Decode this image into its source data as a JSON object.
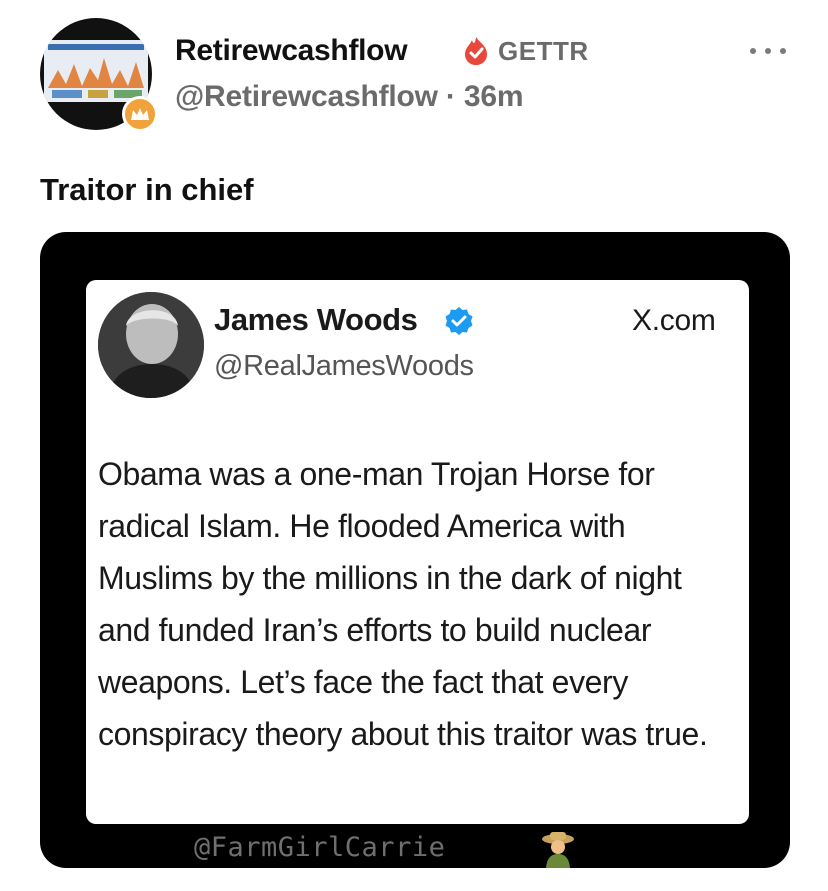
{
  "post": {
    "author_name": "Retirewcashflow",
    "platform": "GETTR",
    "handle_time": "@Retirewcashflow · 36m",
    "text": "Traitor in chief",
    "avatar_icon": "chart-avatar",
    "badge_icon": "crown-badge-icon",
    "verified_icon": "red-verified-flame-icon",
    "more_icon": "more-options-icon"
  },
  "embedded": {
    "name": "James Woods",
    "handle": "@RealJamesWoods",
    "site": "X.com",
    "quote": "Obama was a one-man Trojan Horse for radical Islam. He flooded America with Muslims by the millions in the dark of night and funded Iran’s efforts to build nuclear weapons. Let’s face the fact that every conspiracy theory about this traitor was true.",
    "verified_icon": "blue-verified-icon",
    "watermark": "@FarmGirlCarrie",
    "watermark_icon": "farmer-emoji-icon"
  },
  "colors": {
    "accent_red": "#e8483b",
    "verified_blue": "#1d9bf0",
    "badge_orange": "#f2a23a",
    "muted_gray": "#6b6b6b"
  }
}
